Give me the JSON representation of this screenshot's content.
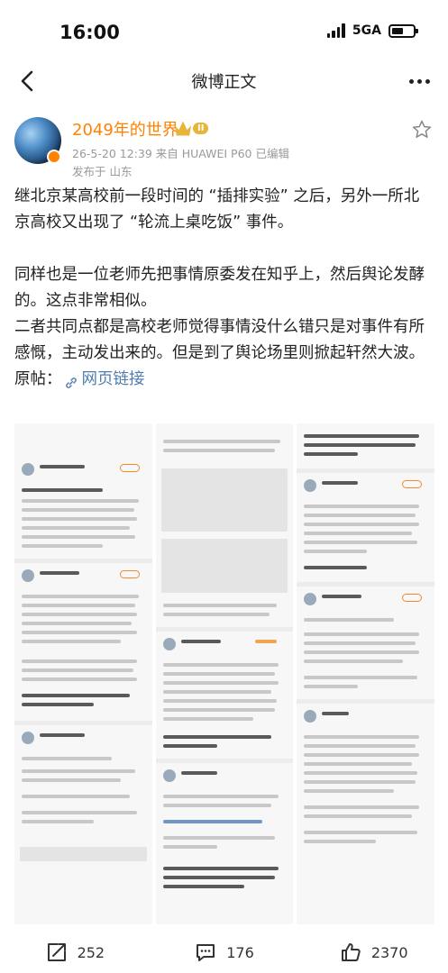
{
  "status_bar": {
    "time": "16:00",
    "network": "5GA"
  },
  "nav": {
    "title": "微博正文"
  },
  "author": {
    "name": "2049年的世界",
    "level": "II",
    "meta": "26-5-20 12:39  来自 HUAWEI P60  已编辑",
    "location": "发布于 山东"
  },
  "post": {
    "p1": "继北京某高校前一段时间的 “插排实验” 之后，另外一所北京高校又出现了 “轮流上桌吃饭” 事件。",
    "p2": "同样也是一位老师先把事情原委发在知乎上，然后舆论发酵的。这点非常相似。",
    "p3": "二者共同点都是高校老师觉得事情没什么错只是对事件有所感慨，主动发出来的。但是到了舆论场里则掀起轩然大波。",
    "link_prefix": "原帖：",
    "link_text": "网页链接"
  },
  "actions": {
    "reposts": "252",
    "comments": "176",
    "likes": "2370"
  },
  "icons": {
    "back": "back-arrow-icon",
    "more": "more-dots-icon",
    "star": "star-icon",
    "link": "link-icon",
    "repost": "repost-icon",
    "comment": "comment-icon",
    "like": "like-icon"
  },
  "colors": {
    "author_name": "#ff8200",
    "link": "#507daf",
    "meta": "#999999"
  }
}
